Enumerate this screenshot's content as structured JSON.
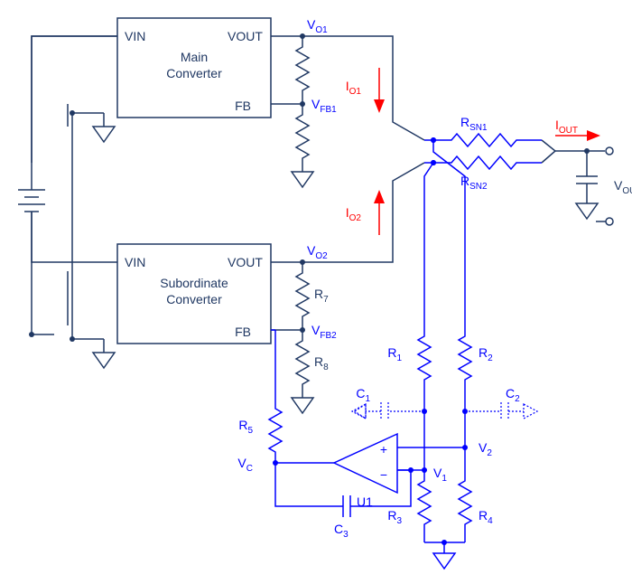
{
  "converters": {
    "main": {
      "title1": "Main",
      "title2": "Converter",
      "vin": "VIN",
      "vout": "VOUT",
      "fb": "FB"
    },
    "sub": {
      "title1": "Subordinate",
      "title2": "Converter",
      "vin": "VIN",
      "vout": "VOUT",
      "fb": "FB"
    }
  },
  "labels": {
    "VO1": "V",
    "VO1_sub": "O1",
    "VFB1": "V",
    "VFB1_sub": "FB1",
    "VO2": "V",
    "VO2_sub": "O2",
    "VFB2": "V",
    "VFB2_sub": "FB2",
    "R7": "R",
    "R7_sub": "7",
    "R8": "R",
    "R8_sub": "8",
    "R5": "R",
    "R5_sub": "5",
    "R1": "R",
    "R1_sub": "1",
    "R2": "R",
    "R2_sub": "2",
    "R3": "R",
    "R3_sub": "3",
    "R4": "R",
    "R4_sub": "4",
    "RSN1": "R",
    "RSN1_sub": "SN1",
    "RSN2": "R",
    "RSN2_sub": "SN2",
    "C1": "C",
    "C1_sub": "1",
    "C2": "C",
    "C2_sub": "2",
    "C3": "C",
    "C3_sub": "3",
    "V1": "V",
    "V1_sub": "1",
    "V2": "V",
    "V2_sub": "2",
    "VC": "V",
    "VC_sub": "C",
    "VOUT": "V",
    "VOUT_sub": "OUT",
    "IO1": "I",
    "IO1_sub": "O1",
    "IO2": "I",
    "IO2_sub": "O2",
    "IOUT": "I",
    "IOUT_sub": "OUT",
    "U1": "U1",
    "plus": "+",
    "minus": "−"
  }
}
